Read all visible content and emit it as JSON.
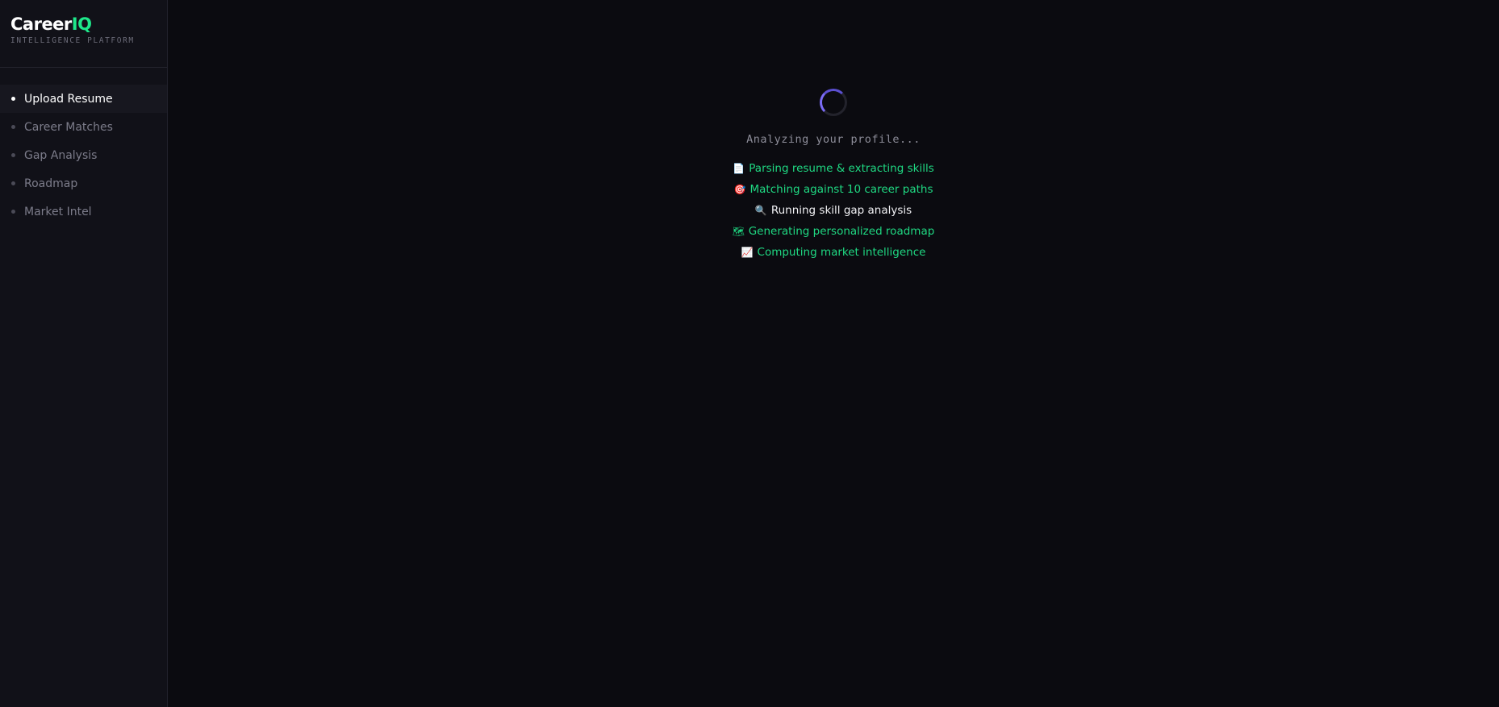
{
  "brand": {
    "name_part1": "Career",
    "name_part2": "IQ",
    "subtitle": "INTELLIGENCE PLATFORM",
    "accent": "#1ee88a"
  },
  "sidebar": {
    "items": [
      {
        "label": "Upload Resume",
        "active": true
      },
      {
        "label": "Career Matches",
        "active": false
      },
      {
        "label": "Gap Analysis",
        "active": false
      },
      {
        "label": "Roadmap",
        "active": false
      },
      {
        "label": "Market Intel",
        "active": false
      }
    ]
  },
  "loader": {
    "status_text": "Analyzing your profile...",
    "spinner_color": "#7b6cf6",
    "steps": [
      {
        "icon": "document-icon",
        "glyph": "📄",
        "label": "Parsing resume & extracting skills",
        "state": "done"
      },
      {
        "icon": "target-icon",
        "glyph": "🎯",
        "label": "Matching against 10 career paths",
        "state": "done"
      },
      {
        "icon": "magnifier-icon",
        "glyph": "🔍",
        "label": "Running skill gap analysis",
        "state": "current"
      },
      {
        "icon": "map-icon",
        "glyph": "🗺",
        "label": "Generating personalized roadmap",
        "state": "done"
      },
      {
        "icon": "chart-icon",
        "glyph": "📈",
        "label": "Computing market intelligence",
        "state": "done"
      }
    ]
  }
}
